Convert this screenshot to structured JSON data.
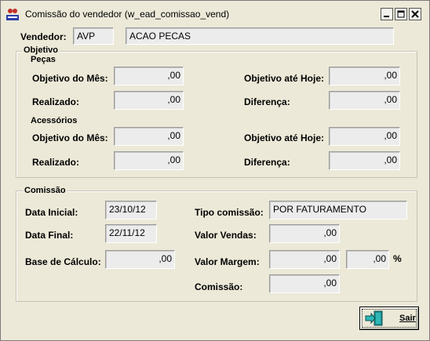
{
  "window": {
    "title": "Comissão do vendedor (w_ead_comissao_vend)"
  },
  "vendedor": {
    "label": "Vendedor:",
    "code": "AVP",
    "name": "ACAO PECAS"
  },
  "objetivo": {
    "title": "Objetivo",
    "pecas": {
      "title": "Peças",
      "objetivo_mes_label": "Objetivo do Mês:",
      "objetivo_mes": ",00",
      "objetivo_hoje_label": "Objetivo até Hoje:",
      "objetivo_hoje": ",00",
      "realizado_label": "Realizado:",
      "realizado": ",00",
      "diferenca_label": "Diferença:",
      "diferenca": ",00"
    },
    "acessorios": {
      "title": "Acessórios",
      "objetivo_mes_label": "Objetivo do Mês:",
      "objetivo_mes": ",00",
      "objetivo_hoje_label": "Objetivo até Hoje:",
      "objetivo_hoje": ",00",
      "realizado_label": "Realizado:",
      "realizado": ",00",
      "diferenca_label": "Diferença:",
      "diferenca": ",00"
    }
  },
  "comissao": {
    "title": "Comissão",
    "data_inicial_label": "Data Inicial:",
    "data_inicial": "23/10/12",
    "data_final_label": "Data Final:",
    "data_final": "22/11/12",
    "base_calculo_label": "Base de Cálculo:",
    "base_calculo": ",00",
    "tipo_label": "Tipo comissão:",
    "tipo": "POR FATURAMENTO",
    "valor_vendas_label": "Valor Vendas:",
    "valor_vendas": ",00",
    "valor_margem_label": "Valor Margem:",
    "valor_margem": ",00",
    "margem_percent": ",00",
    "percent_sign": "%",
    "comissao_label": "Comissão:",
    "comissao_value": ",00"
  },
  "buttons": {
    "sair": "Sair"
  }
}
